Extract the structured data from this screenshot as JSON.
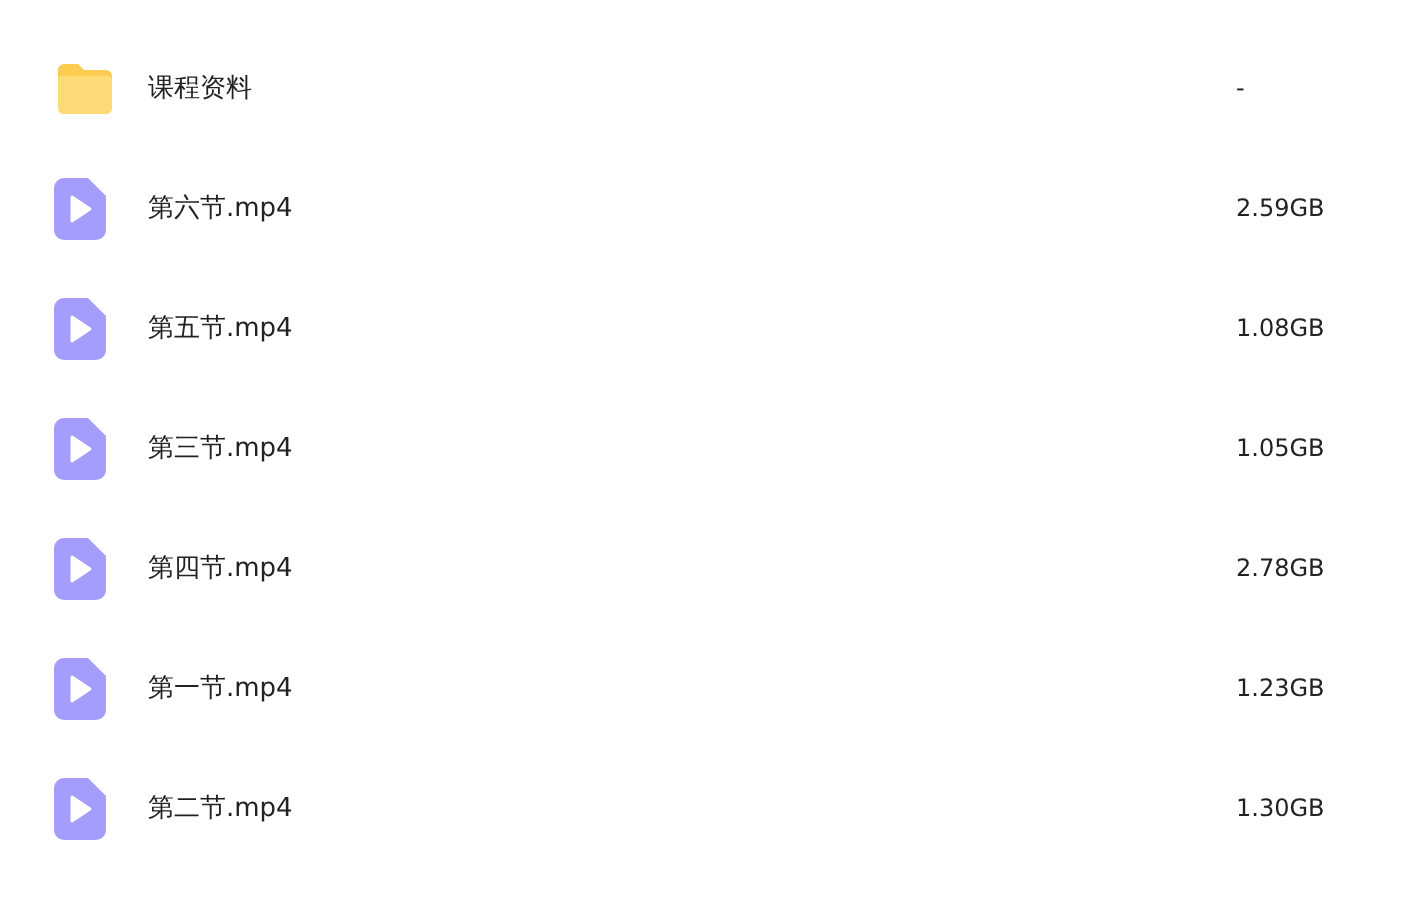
{
  "files": [
    {
      "kind": "folder",
      "name": "课程资料",
      "size": "-"
    },
    {
      "kind": "video",
      "name": "第六节.mp4",
      "size": "2.59GB"
    },
    {
      "kind": "video",
      "name": "第五节.mp4",
      "size": "1.08GB"
    },
    {
      "kind": "video",
      "name": "第三节.mp4",
      "size": "1.05GB"
    },
    {
      "kind": "video",
      "name": "第四节.mp4",
      "size": "2.78GB"
    },
    {
      "kind": "video",
      "name": "第一节.mp4",
      "size": "1.23GB"
    },
    {
      "kind": "video",
      "name": "第二节.mp4",
      "size": "1.30GB"
    }
  ]
}
